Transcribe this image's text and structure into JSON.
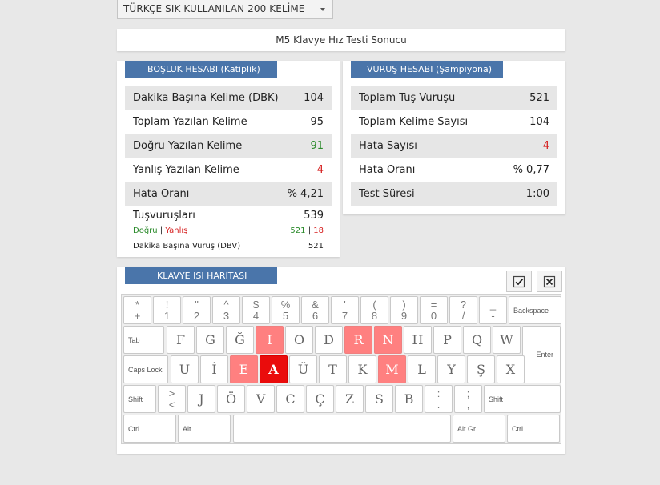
{
  "dropdown": {
    "selected": "TÜRKÇE SIK KULLANILAN 200 KELİME"
  },
  "title": "M5 Klavye Hız Testi Sonucu",
  "left_panel": {
    "header": "BOŞLUK HESABI (Katiplik)",
    "rows": [
      {
        "label": "Dakika Başına Kelime (DBK)",
        "value": "104"
      },
      {
        "label": "Toplam Yazılan Kelime",
        "value": "95"
      },
      {
        "label": "Doğru Yazılan Kelime",
        "value": "91"
      },
      {
        "label": "Yanlış Yazılan Kelime",
        "value": "4"
      },
      {
        "label": "Hata Oranı",
        "value": "% 4,21"
      },
      {
        "label": "Tuşvuruşları",
        "value": "539"
      }
    ],
    "sub": {
      "correct_label": "Doğru",
      "sep": "|",
      "wrong_label": "Yanlış",
      "correct_value": "521",
      "wrong_value": "18",
      "dbv_label": "Dakika Başına Vuruş (DBV)",
      "dbv_value": "521"
    }
  },
  "right_panel": {
    "header": "VURUŞ HESABI (Şampiyona)",
    "rows": [
      {
        "label": "Toplam Tuş Vuruşu",
        "value": "521"
      },
      {
        "label": "Toplam Kelime Sayısı",
        "value": "104"
      },
      {
        "label": "Hata Sayısı",
        "value": "4"
      },
      {
        "label": "Hata Oranı",
        "value": "% 0,77"
      },
      {
        "label": "Test Süresi",
        "value": "1:00"
      }
    ]
  },
  "keyboard": {
    "header": "KLAVYE ISI HARİTASI",
    "buttons": {
      "check_icon": "checkbox-check-icon",
      "close_icon": "close-x-icon"
    },
    "colors": {
      "heat_low": "#ff8080",
      "heat_high": "#ea0c0c"
    },
    "rows": [
      [
        {
          "top": "*",
          "bottom": "+"
        },
        {
          "top": "!",
          "bottom": "1"
        },
        {
          "top": "\"",
          "bottom": "2"
        },
        {
          "top": "^",
          "bottom": "3"
        },
        {
          "top": "$",
          "bottom": "4"
        },
        {
          "top": "%",
          "bottom": "5"
        },
        {
          "top": "&",
          "bottom": "6"
        },
        {
          "top": "'",
          "bottom": "7"
        },
        {
          "top": "(",
          "bottom": "8"
        },
        {
          "top": ")",
          "bottom": "9"
        },
        {
          "top": "=",
          "bottom": "0"
        },
        {
          "top": "?",
          "bottom": "/"
        },
        {
          "top": "_",
          "bottom": "-"
        },
        {
          "label": "Backspace",
          "fn": true
        }
      ],
      [
        {
          "label": "Tab",
          "fn": true
        },
        {
          "label": "F"
        },
        {
          "label": "G"
        },
        {
          "label": "Ğ"
        },
        {
          "label": "I",
          "heat": 1
        },
        {
          "label": "O"
        },
        {
          "label": "D"
        },
        {
          "label": "R",
          "heat": 1
        },
        {
          "label": "N",
          "heat": 1
        },
        {
          "label": "H"
        },
        {
          "label": "P"
        },
        {
          "label": "Q"
        },
        {
          "label": "W"
        },
        {
          "label": "Enter",
          "fn": true
        }
      ],
      [
        {
          "label": "Caps Lock",
          "fn": true
        },
        {
          "label": "U"
        },
        {
          "label": "İ"
        },
        {
          "label": "E",
          "heat": 1
        },
        {
          "label": "A",
          "heat": 2
        },
        {
          "label": "Ü"
        },
        {
          "label": "T"
        },
        {
          "label": "K"
        },
        {
          "label": "M",
          "heat": 1
        },
        {
          "label": "L"
        },
        {
          "label": "Y"
        },
        {
          "label": "Ş"
        },
        {
          "label": "X"
        }
      ],
      [
        {
          "label": "Shift",
          "fn": true
        },
        {
          "top": ">",
          "bottom": "<"
        },
        {
          "label": "J"
        },
        {
          "label": "Ö"
        },
        {
          "label": "V"
        },
        {
          "label": "C"
        },
        {
          "label": "Ç"
        },
        {
          "label": "Z"
        },
        {
          "label": "S"
        },
        {
          "label": "B"
        },
        {
          "top": ":",
          "bottom": "."
        },
        {
          "top": ";",
          "bottom": ","
        },
        {
          "label": "Shift",
          "fn": true
        }
      ],
      [
        {
          "label": "Ctrl",
          "fn": true
        },
        {
          "label": "Alt",
          "fn": true
        },
        {
          "label": "",
          "fn": true
        },
        {
          "label": "Alt Gr",
          "fn": true
        },
        {
          "label": "Ctrl",
          "fn": true
        }
      ]
    ]
  }
}
